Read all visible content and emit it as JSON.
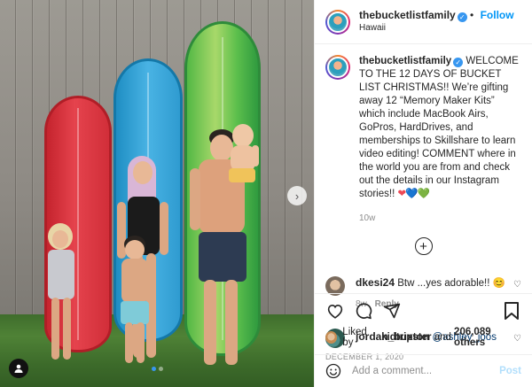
{
  "post": {
    "author": "thebucketlistfamily",
    "follow_label": "Follow",
    "separator": "•",
    "location": "Hawaii",
    "caption": "WELCOME TO THE 12 DAYS OF BUCKET LIST CHRISTMAS!! We’re gifting away 12 “Memory Maker Kits” which include MacBook Airs, GoPros, HardDrives, and memberships to Skillshare to learn video editing! COMMENT where in the world you are from and check out the details in our Instagram stories!!",
    "caption_emoji": [
      "❤",
      "💙",
      "💚"
    ],
    "caption_age": "10w",
    "load_more_label": "+",
    "date": "DECEMBER 1, 2020"
  },
  "comments": [
    {
      "user": "dkesi24",
      "text": "Btw ...yes adorable!! 😊",
      "age": "8w",
      "reply_label": "Reply"
    },
    {
      "user": "jordan_buxton",
      "mention": "@ashley_joos"
    }
  ],
  "likes": {
    "prefix": "Liked by",
    "user": "kidtripster",
    "middle": "and",
    "count": "206,089 others"
  },
  "composer": {
    "placeholder": "Add a comment...",
    "post_label": "Post"
  },
  "icons": {
    "next": "chevron-right-icon",
    "tag": "user-tag-icon",
    "like": "heart-outline-icon",
    "comment": "comment-bubble-icon",
    "share": "paper-plane-icon",
    "save": "bookmark-icon",
    "emoji": "smiley-icon",
    "verified": "verified-badge-icon"
  },
  "colors": {
    "link": "#0095f6",
    "verified": "#3897f0",
    "muted": "#8e8e8e",
    "post_disabled": "#b2dffc"
  }
}
